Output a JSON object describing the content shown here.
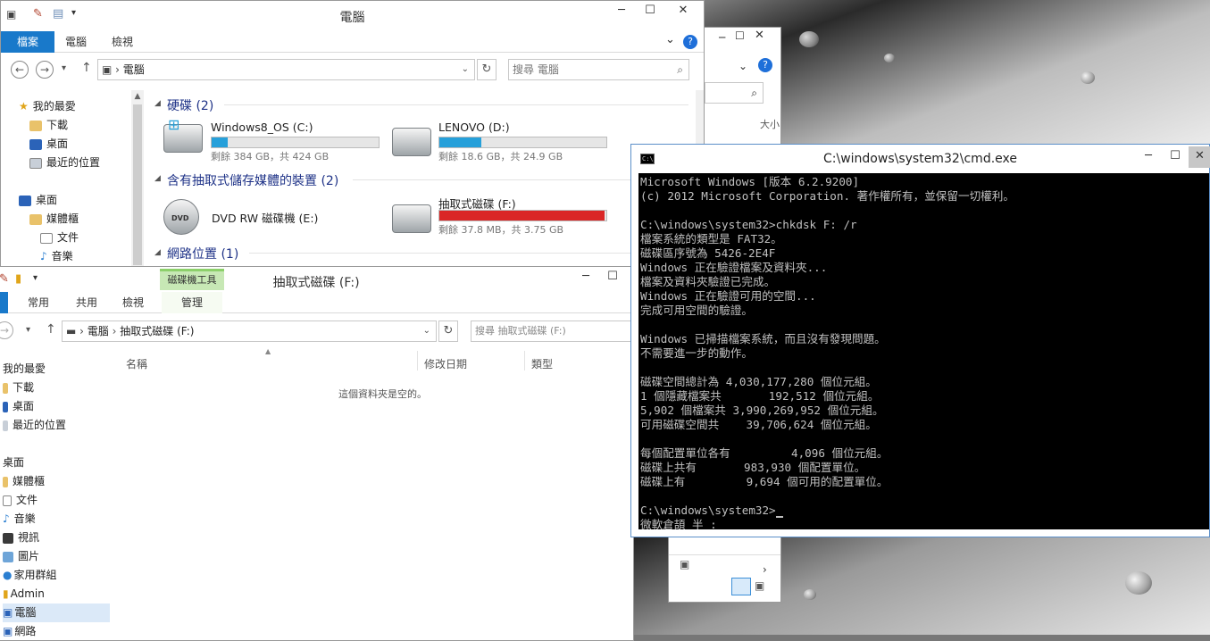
{
  "win1": {
    "title": "電腦",
    "tabs": [
      "檔案",
      "電腦",
      "檢視"
    ],
    "address": "電腦",
    "search_placeholder": "搜尋 電腦",
    "nav": [
      "我的最愛",
      "下載",
      "桌面",
      "最近的位置",
      "桌面",
      "媒體櫃",
      "文件",
      "音樂"
    ],
    "groups": {
      "hdd": "硬碟 (2)",
      "removable": "含有抽取式儲存媒體的裝置 (2)",
      "network": "網路位置 (1)"
    },
    "drives": [
      {
        "name": "Windows8_OS (C:)",
        "info": "剩餘 384 GB，共 424 GB",
        "used": 0.094,
        "color": "#26a0da"
      },
      {
        "name": "LENOVO (D:)",
        "info": "剩餘 18.6 GB，共 24.9 GB",
        "used": 0.253,
        "color": "#26a0da"
      },
      {
        "name": "DVD RW 磁碟機 (E:)",
        "info": "",
        "used": null,
        "color": ""
      },
      {
        "name": "抽取式磁碟 (F:)",
        "info": "剩餘 37.8 MB，共 3.75 GB",
        "used": 0.99,
        "color": "#da2626"
      }
    ]
  },
  "win2": {
    "title": "抽取式磁碟 (F:)",
    "context_tab": "磁碟機工具",
    "tabs": [
      "常用",
      "共用",
      "檢視",
      "管理"
    ],
    "address_parts": [
      "電腦",
      "抽取式磁碟 (F:)"
    ],
    "search_placeholder": "搜尋 抽取式磁碟 (F:)",
    "columns": [
      "名稱",
      "修改日期",
      "類型"
    ],
    "empty_message": "這個資料夾是空的。",
    "nav": [
      "我的最愛",
      "下載",
      "桌面",
      "最近的位置",
      "桌面",
      "媒體櫃",
      "文件",
      "音樂",
      "視訊",
      "圖片",
      "家用群組",
      "Admin",
      "電腦",
      "網路"
    ]
  },
  "cmd": {
    "title": "C:\\windows\\system32\\cmd.exe",
    "lines": [
      "Microsoft Windows [版本 6.2.9200]",
      "(c) 2012 Microsoft Corporation. 著作權所有，並保留一切權利。",
      "",
      "C:\\windows\\system32>chkdsk F: /r",
      "檔案系統的類型是 FAT32。",
      "磁碟區序號為 5426-2E4F",
      "Windows 正在驗證檔案及資料夾...",
      "檔案及資料夾驗證已完成。",
      "Windows 正在驗證可用的空間...",
      "完成可用空間的驗證。",
      "",
      "Windows 已掃描檔案系統，而且沒有發現問題。",
      "不需要進一步的動作。",
      "",
      "磁碟空間總計為 4,030,177,280 個位元組。",
      "1 個隱藏檔案共       192,512 個位元組。",
      "5,902 個檔案共 3,990,269,952 個位元組。",
      "可用磁碟空間共    39,706,624 個位元組。",
      "",
      "每個配置單位各有         4,096 個位元組。",
      "磁碟上共有       983,930 個配置單位。",
      "磁碟上有         9,694 個可用的配置單位。",
      "",
      "C:\\windows\\system32>",
      "微軟倉頡 半 :"
    ]
  },
  "behind": {
    "size_label": "大小"
  }
}
